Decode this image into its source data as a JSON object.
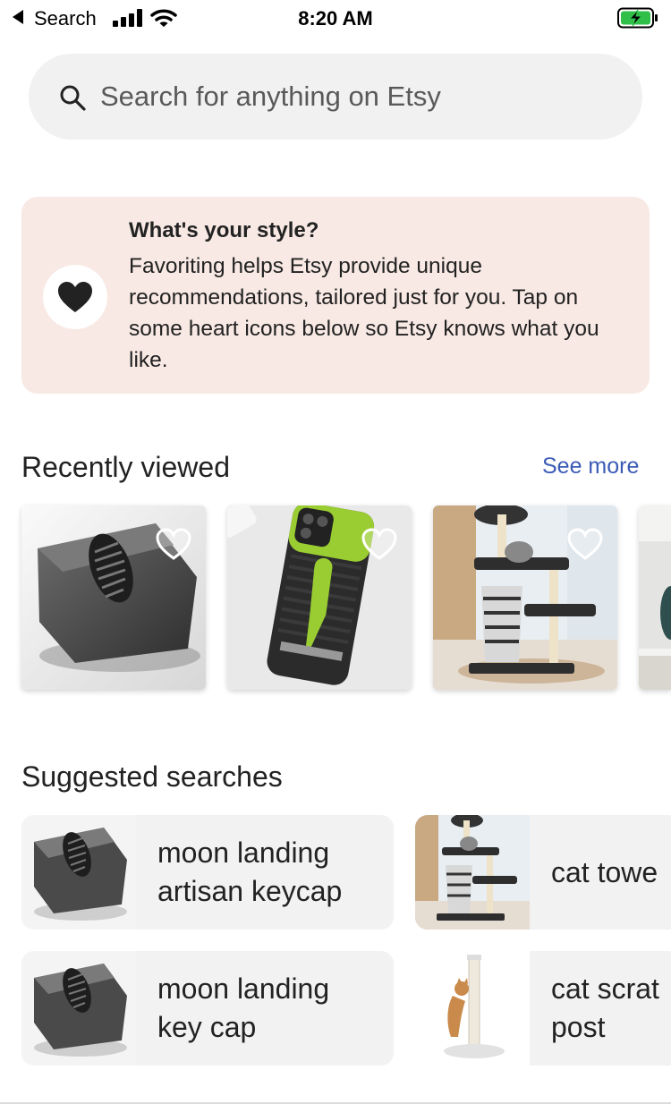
{
  "status_bar": {
    "back_app": "Search",
    "time": "8:20 AM",
    "battery_color": "#30c04a"
  },
  "search": {
    "placeholder": "Search for anything on Etsy",
    "icon": "search-icon"
  },
  "style_prompt": {
    "title": "What's your style?",
    "body": "Favoriting helps Etsy provide unique recommendations, tailored just for you. Tap on some heart icons below so Etsy knows what you like.",
    "background": "#f8e9e4",
    "icon": "heart-filled-icon"
  },
  "recently_viewed": {
    "title": "Recently viewed",
    "see_more": "See more",
    "items": [
      {
        "name": "moon landing keycap",
        "favorited": false
      },
      {
        "name": "phone case",
        "favorited": false
      },
      {
        "name": "cat tower",
        "favorited": false
      },
      {
        "name": "partial item",
        "favorited": false
      }
    ]
  },
  "suggested": {
    "title": "Suggested searches",
    "items": [
      {
        "label": "moon landing\nartisan keycap",
        "thumb": "keycap"
      },
      {
        "label": "cat towe",
        "thumb": "cat-tower"
      },
      {
        "label": "moon landing\nkey cap",
        "thumb": "keycap"
      },
      {
        "label": "cat scrat\npost",
        "thumb": "scratch-post"
      }
    ]
  },
  "colors": {
    "link": "#3b5bb5",
    "card_bg": "#f2f2f2",
    "text": "#222222"
  }
}
